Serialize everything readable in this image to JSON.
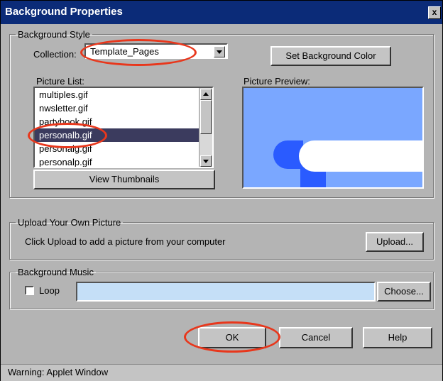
{
  "dialog": {
    "title": "Background Properties",
    "close_glyph": "x"
  },
  "background_style": {
    "legend": "Background Style",
    "collection_label": "Collection:",
    "collection_value": "Template_Pages",
    "set_color_button": "Set Background Color",
    "picture_list_label": "Picture List:",
    "picture_list": [
      "multiples.gif",
      "nwsletter.gif",
      "partybook.gif",
      "personalb.gif",
      "personalg.gif",
      "personalp.gif"
    ],
    "selected_index": 3,
    "view_thumbnails_button": "View Thumbnails",
    "preview_label": "Picture Preview:",
    "preview_colors": {
      "background": "#7aa7ff",
      "shape_dark": "#2a5bff",
      "shape_white": "#ffffff"
    }
  },
  "upload": {
    "legend": "Upload Your Own Picture",
    "description": "Click Upload to add a picture from your computer",
    "upload_button": "Upload..."
  },
  "music": {
    "legend": "Background Music",
    "loop_label": "Loop",
    "loop_checked": false,
    "file_value": "",
    "choose_button": "Choose..."
  },
  "footer": {
    "ok_button": "OK",
    "cancel_button": "Cancel",
    "help_button": "Help"
  },
  "status_bar": {
    "text": "Warning: Applet Window"
  },
  "colors": {
    "title_bar": "#0b2b78",
    "dialog_bg": "#b4b4b4",
    "annotation": "#e8371c",
    "music_field": "#c5dff7"
  }
}
